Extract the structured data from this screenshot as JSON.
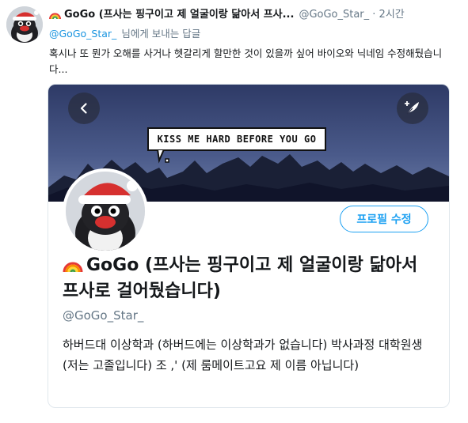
{
  "tweet": {
    "display_name": "GoGo (프사는 핑구이고 제 얼굴이랑 닮아서 프사...",
    "handle": "@GoGo_Star_",
    "time": " · 2시간",
    "reply_mention": "@GoGo_Star_",
    "reply_rest": "님에게 보내는 답글",
    "text": "혹시나 또 뭔가 오해를 사거나 헷갈리게 할만한 것이 있을까 싶어 바이오와 닉네임 수정해뒀습니다..."
  },
  "profile_card": {
    "banner_caption": "KISS ME HARD BEFORE YOU GO",
    "edit_button": "프로필 수정",
    "display_name": "GoGo (프사는 핑구이고 제 얼굴이랑 닮아서 프사로 걸어뒀습니다)",
    "handle": "@GoGo_Star_",
    "bio": "하버드대 이상학과 (하버드에는 이상학과가 없습니다) 박사과정 대학원생 (저는 고졸입니다) 조 ,' (제 룸메이트고요 제 이름 아닙니다)"
  },
  "icons": {
    "rainbow": "rainbow-emoji-icon",
    "back": "chevron-left-icon",
    "compose": "feather-compose-icon"
  },
  "colors": {
    "link_blue": "#1b95e0",
    "accent": "#1da1f2",
    "secondary_text": "#657786",
    "card_border": "#e1e8ed"
  }
}
